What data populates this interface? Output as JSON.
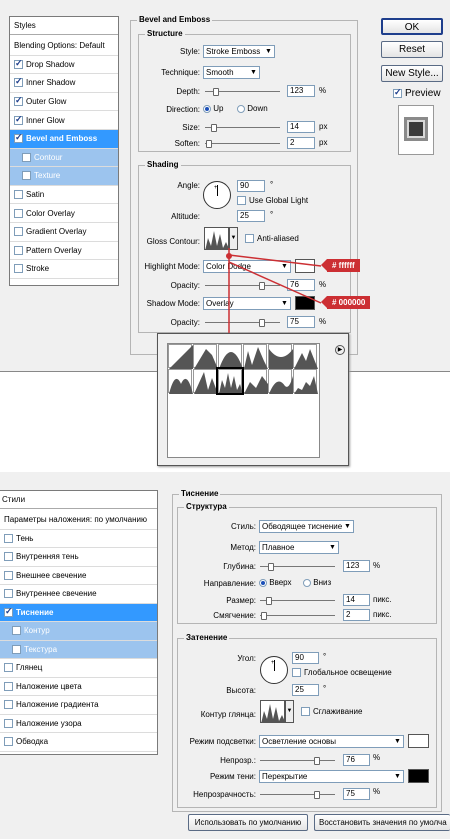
{
  "en": {
    "styles_title": "Styles",
    "styles_items": [
      {
        "label": "Blending Options: Default",
        "checkbox": false,
        "state": "normal"
      },
      {
        "label": "Drop Shadow",
        "checkbox": true,
        "checked": true,
        "state": "normal"
      },
      {
        "label": "Inner Shadow",
        "checkbox": true,
        "checked": true,
        "state": "normal"
      },
      {
        "label": "Outer Glow",
        "checkbox": true,
        "checked": true,
        "state": "normal"
      },
      {
        "label": "Inner Glow",
        "checkbox": true,
        "checked": true,
        "state": "normal"
      },
      {
        "label": "Bevel and Emboss",
        "checkbox": true,
        "checked": true,
        "state": "selected"
      },
      {
        "label": "Contour",
        "checkbox": true,
        "checked": false,
        "state": "sub"
      },
      {
        "label": "Texture",
        "checkbox": true,
        "checked": false,
        "state": "sub"
      },
      {
        "label": "Satin",
        "checkbox": true,
        "checked": false,
        "state": "normal"
      },
      {
        "label": "Color Overlay",
        "checkbox": true,
        "checked": false,
        "state": "normal"
      },
      {
        "label": "Gradient Overlay",
        "checkbox": true,
        "checked": false,
        "state": "normal"
      },
      {
        "label": "Pattern Overlay",
        "checkbox": true,
        "checked": false,
        "state": "normal"
      },
      {
        "label": "Stroke",
        "checkbox": true,
        "checked": false,
        "state": "normal"
      }
    ],
    "bevel_title": "Bevel and Emboss",
    "structure_title": "Structure",
    "style_label": "Style:",
    "style_value": "Stroke Emboss",
    "technique_label": "Technique:",
    "technique_value": "Smooth",
    "depth_label": "Depth:",
    "depth_value": "123",
    "depth_unit": "%",
    "direction_label": "Direction:",
    "dir_up": "Up",
    "dir_down": "Down",
    "size_label": "Size:",
    "size_value": "14",
    "size_unit": "px",
    "soften_label": "Soften:",
    "soften_value": "2",
    "soften_unit": "px",
    "shading_title": "Shading",
    "angle_label": "Angle:",
    "angle_value": "90",
    "angle_unit": "°",
    "global_light": "Use Global Light",
    "altitude_label": "Altitude:",
    "altitude_value": "25",
    "altitude_unit": "°",
    "gloss_label": "Gloss Contour:",
    "anti_aliased": "Anti-aliased",
    "highlight_label": "Highlight Mode:",
    "highlight_value": "Color Dodge",
    "highlight_color_tag": "# ffffff",
    "opacity1_label": "Opacity:",
    "opacity1_value": "76",
    "opacity1_unit": "%",
    "shadow_label": "Shadow Mode:",
    "shadow_value": "Overlay",
    "shadow_color_tag": "# 000000",
    "opacity2_label": "Opacity:",
    "opacity2_value": "75",
    "opacity2_unit": "%",
    "ok": "OK",
    "reset": "Reset",
    "new_style": "New Style...",
    "preview": "Preview"
  },
  "ru": {
    "styles_title": "Стили",
    "styles_items": [
      {
        "label": "Параметры наложения: по умолчанию",
        "checkbox": false,
        "state": "normal"
      },
      {
        "label": "Тень",
        "checkbox": true,
        "checked": false,
        "state": "normal"
      },
      {
        "label": "Внутренняя тень",
        "checkbox": true,
        "checked": false,
        "state": "normal"
      },
      {
        "label": "Внешнее свечение",
        "checkbox": true,
        "checked": false,
        "state": "normal"
      },
      {
        "label": "Внутреннее свечение",
        "checkbox": true,
        "checked": false,
        "state": "normal"
      },
      {
        "label": "Тиснение",
        "checkbox": true,
        "checked": true,
        "state": "selected"
      },
      {
        "label": "Контур",
        "checkbox": true,
        "checked": false,
        "state": "sub"
      },
      {
        "label": "Текстура",
        "checkbox": true,
        "checked": false,
        "state": "sub"
      },
      {
        "label": "Глянец",
        "checkbox": true,
        "checked": false,
        "state": "normal"
      },
      {
        "label": "Наложение цвета",
        "checkbox": true,
        "checked": false,
        "state": "normal"
      },
      {
        "label": "Наложение градиента",
        "checkbox": true,
        "checked": false,
        "state": "normal"
      },
      {
        "label": "Наложение узора",
        "checkbox": true,
        "checked": false,
        "state": "normal"
      },
      {
        "label": "Обводка",
        "checkbox": true,
        "checked": false,
        "state": "normal"
      }
    ],
    "bevel_title": "Тиснение",
    "structure_title": "Структура",
    "style_label": "Стиль:",
    "style_value": "Обводящее тиснение",
    "technique_label": "Метод:",
    "technique_value": "Плавное",
    "depth_label": "Глубина:",
    "depth_value": "123",
    "depth_unit": "%",
    "direction_label": "Направление:",
    "dir_up": "Вверх",
    "dir_down": "Вниз",
    "size_label": "Размер:",
    "size_value": "14",
    "size_unit": "пикс.",
    "soften_label": "Смягчение:",
    "soften_value": "2",
    "soften_unit": "пикс.",
    "shading_title": "Затенение",
    "angle_label": "Угол:",
    "angle_value": "90",
    "angle_unit": "°",
    "global_light": "Глобальное освещение",
    "altitude_label": "Высота:",
    "altitude_value": "25",
    "altitude_unit": "°",
    "gloss_label": "Контур глянца:",
    "anti_aliased": "Сглаживание",
    "highlight_label": "Режим подсветки:",
    "highlight_value": "Осветление основы",
    "opacity1_label": "Непрозр.:",
    "opacity1_value": "76",
    "opacity1_unit": "%",
    "shadow_label": "Режим тени:",
    "shadow_value": "Перекрытие",
    "opacity2_label": "Непрозрачность:",
    "opacity2_value": "75",
    "opacity2_unit": "%",
    "default_btn": "Использовать по умолчанию",
    "restore_btn": "Восстановить значения по умолча"
  },
  "colors": {
    "selection": "#3399ff",
    "sub_selection": "#9cc4ee",
    "callout": "#cc2f33",
    "highlight_color": "#ffffff",
    "shadow_color": "#000000"
  },
  "levels": {
    "depth": 0.12,
    "size": 0.1,
    "soften": 0.02,
    "opacity1": 0.76,
    "opacity2": 0.75
  }
}
